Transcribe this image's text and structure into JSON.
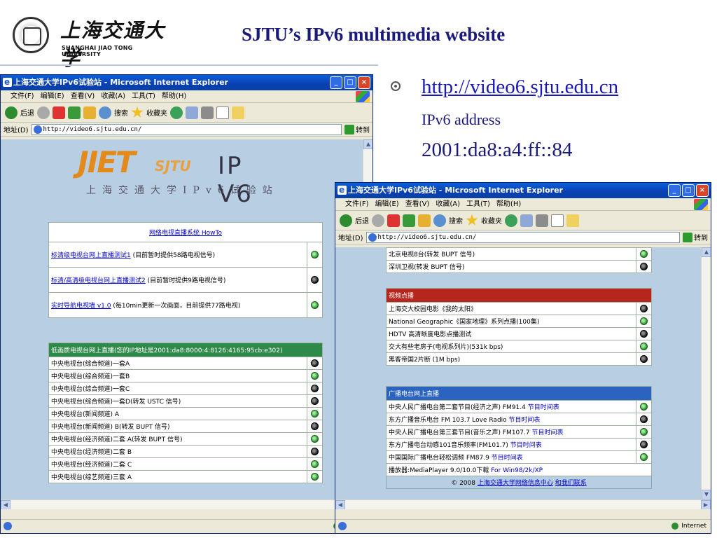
{
  "slide": {
    "logo_cn": "上海交通大学",
    "logo_en": "SHANGHAI JIAO TONG UNIVERSITY",
    "title": "SJTU’s IPv6 multimedia website",
    "link": "http://video6.sjtu.edu.cn",
    "sub": "IPv6 address",
    "address": "2001:da8:a4:ff::84"
  },
  "browser": {
    "title": "上海交通大学IPv6试验站 - Microsoft Internet Explorer",
    "menu": [
      "文件(F)",
      "编辑(E)",
      "查看(V)",
      "收藏(A)",
      "工具(T)",
      "帮助(H)"
    ],
    "back": "后退",
    "search": "搜索",
    "favorites": "收藏夹",
    "address_label": "地址(D)",
    "url": "http://video6.sjtu.edu.cn/",
    "go": "转到",
    "status_zone": "Internet"
  },
  "left_page": {
    "logo_jet": "JIET",
    "logo_sjtu": "SJTU",
    "logo_ipv6": "IP V6",
    "logo_sub": "上海交通大学IPv6试验站",
    "howto": "网络电视直播系统 HowTo",
    "live_rows": [
      {
        "link": "标清级电视台网上直播测试1",
        "note": "(目前暂时提供58路电视信号)",
        "icon": "g"
      },
      {
        "link": "标清/高清级电视台网上直播测试2",
        "note": "(目前暂时提供9路电视信号)",
        "icon": "b"
      },
      {
        "link": "实时导航电视墙 v1.0",
        "note": "(每10min更新一次画面，目前提供77路电视)",
        "icon": "g"
      }
    ],
    "lowq_header": "低画质电视台网上直播(您的IP地址是2001:da8:8000:4:8126:4165:95cb:e302)",
    "channels": [
      {
        "name": "中央电视台(综合频道)一套A",
        "icon": "b"
      },
      {
        "name": "中央电视台(综合频道)一套B",
        "icon": "g"
      },
      {
        "name": "中央电视台(综合频道)一套C",
        "icon": "b"
      },
      {
        "name": "中央电视台(综合频道)一套D(转发 USTC 信号)",
        "icon": "b"
      },
      {
        "name": "中央电视台(新闻频道) A",
        "icon": "g"
      },
      {
        "name": "中央电视台(新闻频道) B(转发 BUPT 信号)",
        "icon": "b"
      },
      {
        "name": "中央电视台(经济频道)二套 A(转发 BUPT 信号)",
        "icon": "g"
      },
      {
        "name": "中央电视台(经济频道)二套 B",
        "icon": "b"
      },
      {
        "name": "中央电视台(经济频道)二套 C",
        "icon": "g"
      },
      {
        "name": "中央电视台(综艺频道)三套 A",
        "icon": "g"
      }
    ]
  },
  "right_page": {
    "top_rows": [
      {
        "name": "北京电视8台(转发 BUPT 信号)",
        "icon": "g"
      },
      {
        "name": "深圳卫视(转发 BUPT 信号)",
        "icon": "b"
      }
    ],
    "vod_header": "视频点播",
    "vod_rows": [
      {
        "name": "上海交大校园电影《我的太阳》",
        "icon": "b"
      },
      {
        "name": "National Geographic《国家地理》系列点播(100集)",
        "icon": "g"
      },
      {
        "name": "HDTV 高清晰度电影点播测试",
        "icon": "b"
      },
      {
        "name": "交大有些老房子(电视系列片)(531k bps)",
        "icon": "g"
      },
      {
        "name": "黑客帝国2片断 (1M bps)",
        "icon": "b"
      }
    ],
    "radio_header": "广播电台网上直播",
    "radio_rows": [
      {
        "name": "中央人民广播电台第二套节目(经济之声) FM91.4",
        "sched": "节目时间表",
        "icon": "g"
      },
      {
        "name": "东方广播音乐电台 FM 103.7 Love Radio",
        "sched": "节目时间表",
        "icon": "b"
      },
      {
        "name": "中央人民广播电台第三套节目(音乐之声) FM107.7",
        "sched": "节目时间表",
        "icon": "g"
      },
      {
        "name": "东方广播电台动感101音乐频率(FM101.7)",
        "sched": "节目时间表",
        "icon": "b"
      },
      {
        "name": "中国国际广播电台轻松调频 FM87.9",
        "sched": "节目时间表",
        "icon": "g"
      }
    ],
    "player": "播放器:MediaPlayer 9.0/10.0下载",
    "player_link": "For Win98/2k/XP",
    "footer": "© 2008",
    "footer_link1": "上海交通大学网络信息中心",
    "footer_link2": "和我们联系"
  }
}
